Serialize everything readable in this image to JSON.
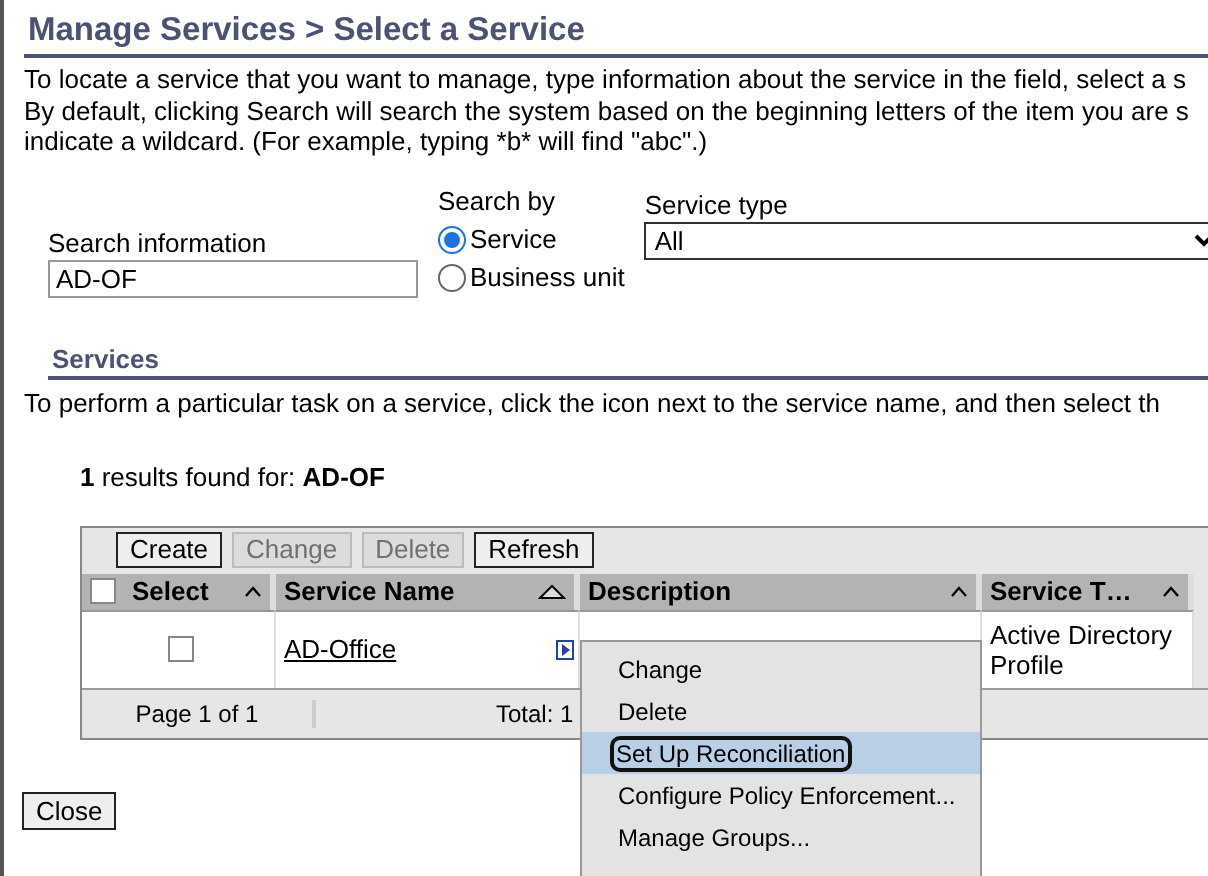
{
  "title": "Manage Services > Select a Service",
  "intro": [
    "To locate a service that you want to manage, type information about the service in the field, select a s",
    "By default, clicking Search will search the system based on the beginning letters of the item you are s",
    "indicate a wildcard. (For example, typing *b* will find \"abc\".)"
  ],
  "search": {
    "label": "Search information",
    "value": "AD-OF"
  },
  "search_by": {
    "label": "Search by",
    "options": [
      {
        "label": "Service",
        "selected": true
      },
      {
        "label": "Business unit",
        "selected": false
      }
    ]
  },
  "service_type": {
    "label": "Service type",
    "value": "All"
  },
  "services": {
    "heading": "Services",
    "instructions": "To perform a particular task on a service, click the icon next to the service name, and then select th",
    "results": "**1** results found for: **AD-OF**",
    "toolbar": [
      {
        "label": "Create",
        "disabled": false
      },
      {
        "label": "Change",
        "disabled": true
      },
      {
        "label": "Delete",
        "disabled": true
      },
      {
        "label": "Refresh",
        "disabled": false
      }
    ],
    "columns": [
      {
        "label": "Select",
        "kind": "check",
        "checked": false
      },
      {
        "label": "Service Name",
        "kind": "sorted"
      },
      {
        "label": "Description",
        "kind": "plain"
      },
      {
        "label": "Service T…",
        "kind": "plain"
      }
    ],
    "rows": [
      {
        "checked": false,
        "name": "AD-Office",
        "type": "Active Directory Profile"
      }
    ],
    "footer": {
      "page": "Page 1 of 1",
      "total": "Total: 1"
    }
  },
  "menu": [
    {
      "label": "Change",
      "selected": false
    },
    {
      "label": "Delete",
      "selected": false
    },
    {
      "label": "Set Up Reconciliation",
      "selected": true
    },
    {
      "label": "Configure Policy Enforcement...",
      "selected": false
    },
    {
      "label": "Manage Groups...",
      "selected": false
    }
  ],
  "close": "Close"
}
